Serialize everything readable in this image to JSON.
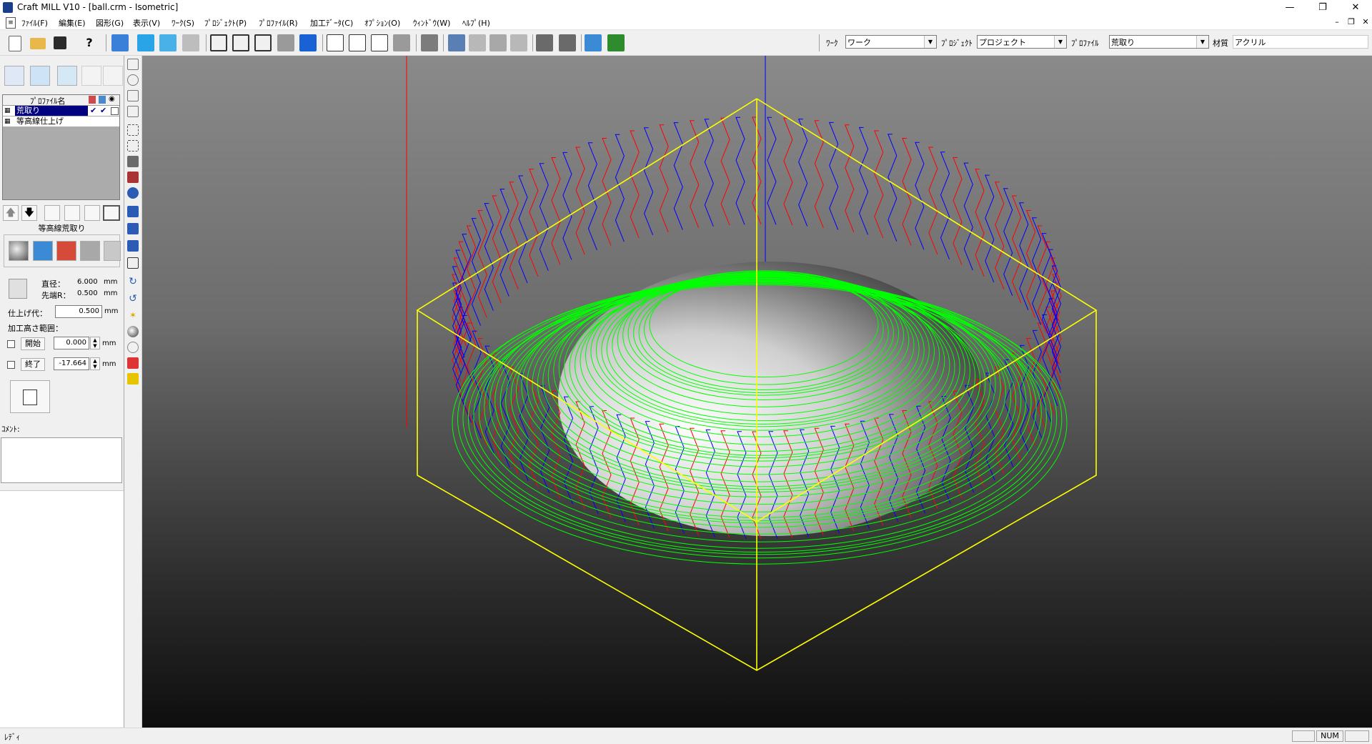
{
  "window": {
    "title": "Craft MILL V10 - [ball.crm - Isometric]"
  },
  "menu": [
    "ﾌｧｲﾙ(F)",
    "編集(E)",
    "図形(G)",
    "表示(V)",
    "ﾜｰｸ(S)",
    "ﾌﾟﾛｼﾞｪｸﾄ(P)",
    "ﾌﾟﾛﾌｧｲﾙ(R)",
    "加工ﾃﾞｰﾀ(C)",
    "ｵﾌﾟｼｮﾝ(O)",
    "ｳｨﾝﾄﾞｳ(W)",
    "ﾍﾙﾌﾟ(H)"
  ],
  "toolbar": {
    "work_label": "ﾜｰｸ",
    "work_value": "ワーク",
    "project_label": "ﾌﾟﾛｼﾞｪｸﾄ",
    "project_value": "プロジェクト",
    "profile_label": "ﾌﾟﾛﾌｧｲﾙ",
    "profile_value": "荒取り",
    "material_label": "材質",
    "material_value": "アクリル"
  },
  "profiles": {
    "header": "ﾌﾟﾛﾌｧｲﾙ名",
    "rows": [
      {
        "name": "荒取り",
        "selected": true
      },
      {
        "name": "等高線仕上げ",
        "selected": false
      }
    ]
  },
  "operation": {
    "name": "等高線荒取り"
  },
  "tool": {
    "diameter_label": "直径：",
    "diameter_value": "6.000",
    "diameter_unit": "mm",
    "tip_label": "先端R：",
    "tip_value": "0.500",
    "tip_unit": "mm"
  },
  "finish": {
    "label": "仕上げ代：",
    "value": "0.500",
    "unit": "mm"
  },
  "range": {
    "label": "加工高さ範囲：",
    "start_label": "開始",
    "start_value": "0.000",
    "start_unit": "mm",
    "end_label": "終了",
    "end_value": "-17.664",
    "end_unit": "mm"
  },
  "comment": {
    "label": "ｺﾒﾝﾄ:",
    "value": ""
  },
  "status": {
    "text": "ﾚﾃﾞｨ",
    "num": "NUM"
  },
  "colors": {
    "bbox": "#ffff00",
    "finish_path": "#00ff00",
    "rough_path": "#ff0000",
    "approach_path": "#0000ff"
  },
  "icons": {
    "toolbar": [
      "new-file-icon",
      "open-folder-icon",
      "save-icon",
      "help-icon",
      "layers-icon",
      "cube-icon",
      "cube-edit-icon",
      "cube-tool-icon",
      "view-front-icon",
      "view-top-icon",
      "view-side-icon",
      "view-shade-icon",
      "view-solid-icon",
      "page-icon",
      "page-export-icon",
      "page-copy-icon",
      "page-tool-icon",
      "tool-icon",
      "sim-icon",
      "sim2-icon",
      "sim3-icon",
      "sim4-icon",
      "machine-icon",
      "machine2-icon",
      "send-icon",
      "run-icon"
    ],
    "vertical": [
      "zoom-in-icon",
      "rotate-icon",
      "pan-icon",
      "fit-icon",
      "zoom-box-icon",
      "zoom-all-icon",
      "view-iso-icon",
      "view-persp-icon",
      "magnify-icon",
      "axis-icon",
      "axis2-icon",
      "axis3-icon",
      "hand-icon",
      "rotate-cw-icon",
      "rotate-ccw-icon",
      "light-icon",
      "shade-icon",
      "wire-icon",
      "toolpath-icon",
      "material-icon"
    ]
  }
}
